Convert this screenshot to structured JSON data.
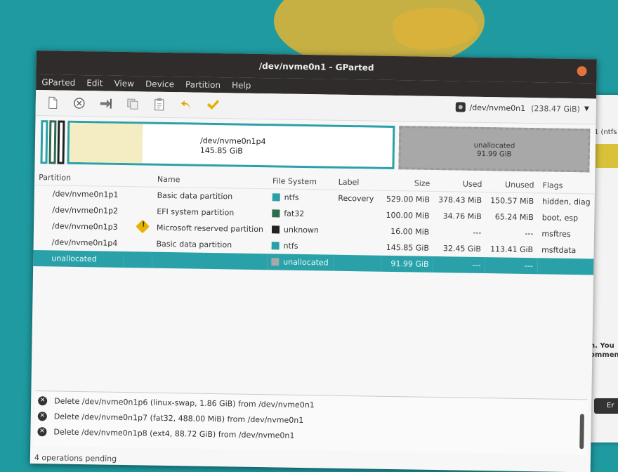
{
  "window": {
    "title": "/dev/nvme0n1 - GParted"
  },
  "menu": [
    "GParted",
    "Edit",
    "View",
    "Device",
    "Partition",
    "Help"
  ],
  "toolbar": {
    "buttons": [
      "new-icon",
      "delete-icon",
      "resize-move-icon",
      "copy-icon",
      "paste-icon",
      "undo-icon",
      "apply-icon"
    ],
    "device": "/dev/nvme0n1",
    "device_size": "(238.47 GiB)"
  },
  "diskmap": {
    "main_label": "/dev/nvme0n1p4",
    "main_size": "145.85 GiB",
    "unalloc_label": "unallocated",
    "unalloc_size": "91.99 GiB"
  },
  "table": {
    "headers": [
      "Partition",
      "Name",
      "File System",
      "Label",
      "Size",
      "Used",
      "Unused",
      "Flags"
    ],
    "rows": [
      {
        "partition": "/dev/nvme0n1p1",
        "name": "Basic data partition",
        "fs": "ntfs",
        "fs_color": "#2aa1a8",
        "label": "Recovery",
        "size": "529.00 MiB",
        "used": "378.43 MiB",
        "unused": "150.57 MiB",
        "flags": "hidden, diag",
        "warn": false
      },
      {
        "partition": "/dev/nvme0n1p2",
        "name": "EFI system partition",
        "fs": "fat32",
        "fs_color": "#2e6b4f",
        "label": "",
        "size": "100.00 MiB",
        "used": "34.76 MiB",
        "unused": "65.24 MiB",
        "flags": "boot, esp",
        "warn": false
      },
      {
        "partition": "/dev/nvme0n1p3",
        "name": "Microsoft reserved partition",
        "fs": "unknown",
        "fs_color": "#222222",
        "label": "",
        "size": "16.00 MiB",
        "used": "---",
        "unused": "---",
        "flags": "msftres",
        "warn": true
      },
      {
        "partition": "/dev/nvme0n1p4",
        "name": "Basic data partition",
        "fs": "ntfs",
        "fs_color": "#2aa1a8",
        "label": "",
        "size": "145.85 GiB",
        "used": "32.45 GiB",
        "unused": "113.41 GiB",
        "flags": "msftdata",
        "warn": false
      },
      {
        "partition": "unallocated",
        "name": "",
        "fs": "unallocated",
        "fs_color": "#a8a8a8",
        "label": "",
        "size": "91.99 GiB",
        "used": "---",
        "unused": "---",
        "flags": "",
        "warn": false,
        "selected": true
      }
    ]
  },
  "operations": [
    "Delete /dev/nvme0n1p6 (linux-swap, 1.86 GiB) from /dev/nvme0n1",
    "Delete /dev/nvme0n1p7 (fat32, 488.00 MiB) from /dev/nvme0n1",
    "Delete /dev/nvme0n1p8 (ext4, 88.72 GiB) from /dev/nvme0n1"
  ],
  "status": "4 operations pending",
  "second_window": {
    "partial_text": "1 (ntfs",
    "text1": "n. You",
    "text2": "ommend",
    "button": "Er"
  }
}
